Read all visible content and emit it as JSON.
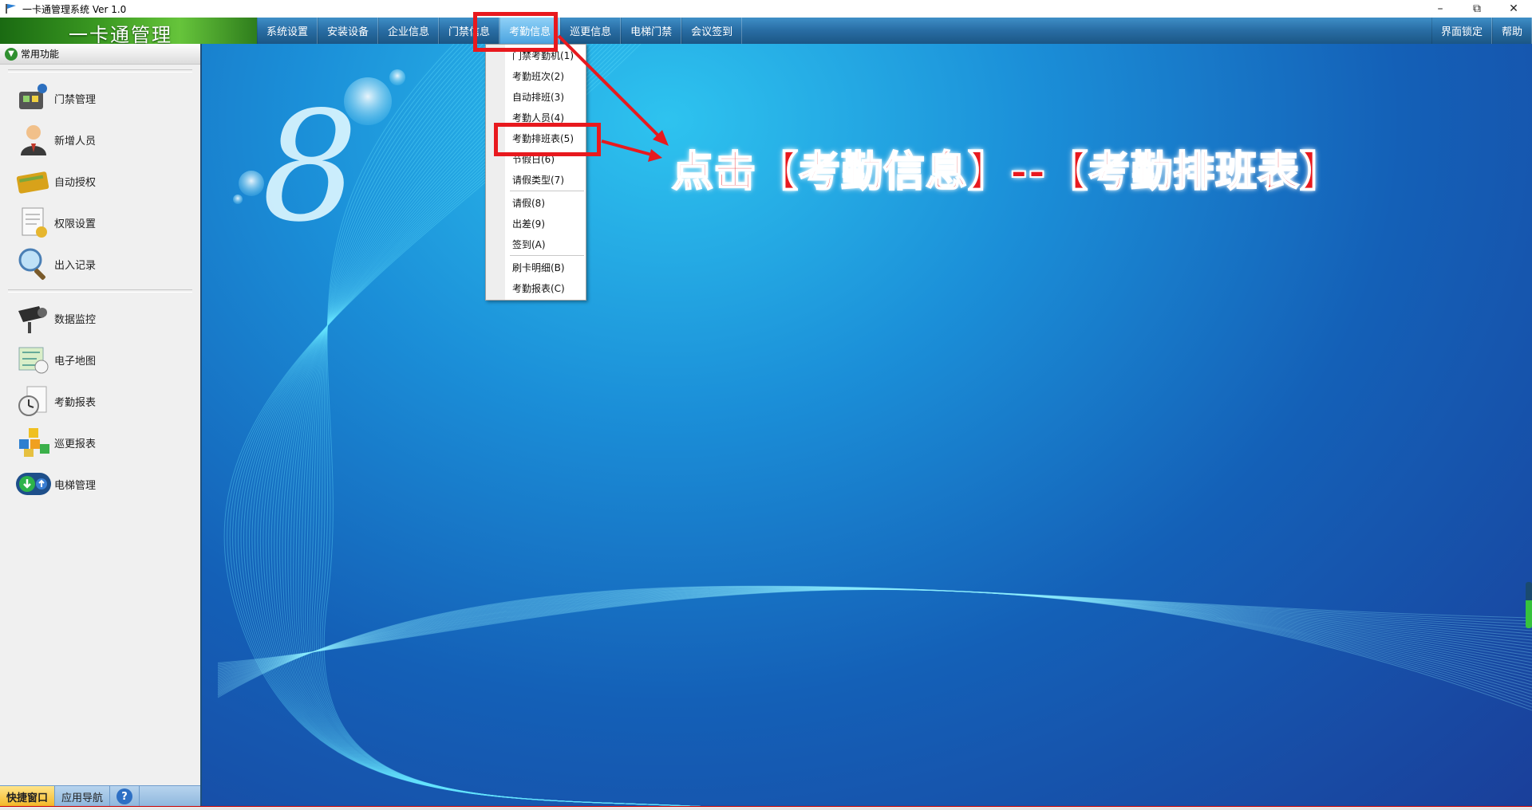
{
  "window": {
    "title": "一卡通管理系统  Ver 1.0",
    "buttons": [
      "minimize",
      "restore",
      "close"
    ]
  },
  "brand": {
    "name": "一卡通管理"
  },
  "menus": [
    {
      "label": "系统设置"
    },
    {
      "label": "安装设备"
    },
    {
      "label": "企业信息"
    },
    {
      "label": "门禁信息"
    },
    {
      "label": "考勤信息",
      "active": true
    },
    {
      "label": "巡更信息"
    },
    {
      "label": "电梯门禁"
    },
    {
      "label": "会议签到"
    }
  ],
  "menus_right": [
    {
      "label": "界面锁定"
    },
    {
      "label": "帮助"
    }
  ],
  "sidebar": {
    "header": "常用功能",
    "group1": [
      {
        "label": "门禁管理",
        "icon": "door-access-icon"
      },
      {
        "label": "新增人员",
        "icon": "person-icon"
      },
      {
        "label": "自动授权",
        "icon": "card-icon"
      },
      {
        "label": "权限设置",
        "icon": "document-icon"
      },
      {
        "label": "出入记录",
        "icon": "magnifier-icon"
      }
    ],
    "group2": [
      {
        "label": "数据监控",
        "icon": "camera-icon"
      },
      {
        "label": "电子地图",
        "icon": "map-icon"
      },
      {
        "label": "考勤报表",
        "icon": "clock-icon"
      },
      {
        "label": "巡更报表",
        "icon": "blocks-icon"
      },
      {
        "label": "电梯管理",
        "icon": "elevator-icon"
      }
    ],
    "tabs": [
      {
        "label": "快捷窗口",
        "active": true
      },
      {
        "label": "应用导航"
      }
    ]
  },
  "dropdown": {
    "items": [
      {
        "label": "门禁考勤机(1)"
      },
      {
        "label": "考勤班次(2)"
      },
      {
        "label": "自动排班(3)"
      },
      {
        "label": "考勤人员(4)"
      },
      {
        "label": "考勤排班表(5)",
        "highlighted": true
      },
      {
        "label": "节假日(6)"
      },
      {
        "label": "请假类型(7)"
      },
      {
        "label": "请假(8)"
      },
      {
        "label": "出差(9)"
      },
      {
        "label": "签到(A)"
      },
      {
        "label": "刷卡明细(B)"
      },
      {
        "label": "考勤报表(C)"
      }
    ]
  },
  "annotation": {
    "text": "点击【考勤信息】--【考勤排班表】",
    "color": "#e8191e"
  },
  "colors": {
    "menubar": "#2a6fa6",
    "brand_green": "#3c9b22",
    "annotation_red": "#e8191e"
  }
}
